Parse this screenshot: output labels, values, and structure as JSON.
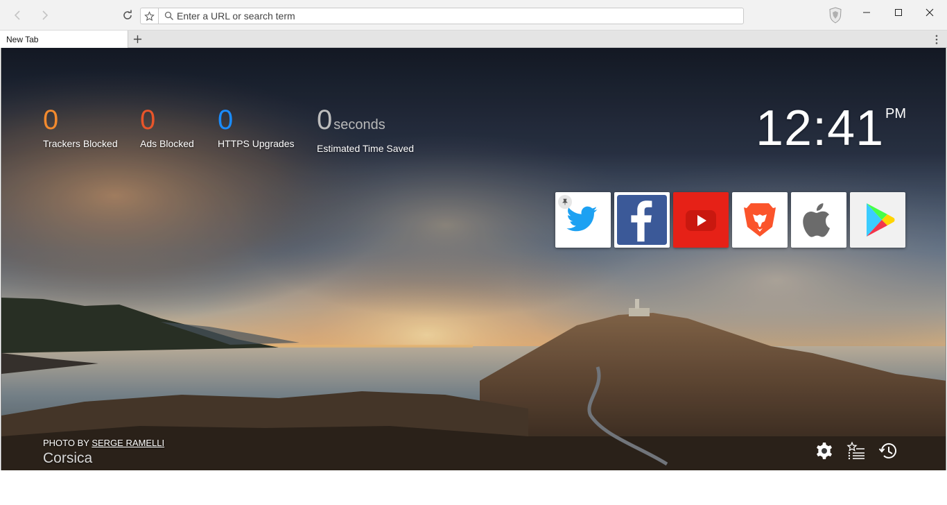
{
  "browser": {
    "address_placeholder": "Enter a URL or search term",
    "tab_title": "New Tab",
    "icons": [
      "back-icon",
      "forward-icon",
      "reload-icon",
      "bookmark-star-icon",
      "search-icon",
      "brave-shield-icon",
      "minimize-icon",
      "maximize-icon",
      "close-icon",
      "new-tab-plus-icon",
      "menu-kebab-icon"
    ]
  },
  "stats": [
    {
      "value": "0",
      "label": "Trackers Blocked",
      "color": "#f28a2e"
    },
    {
      "value": "0",
      "label": "Ads Blocked",
      "color": "#e8552a"
    },
    {
      "value": "0",
      "label": "HTTPS Upgrades",
      "color": "#1a8cff"
    },
    {
      "value": "0",
      "unit": "seconds",
      "label": "Estimated Time Saved",
      "color": "#bdbdbd"
    }
  ],
  "clock": {
    "time": "12:41",
    "ampm": "PM"
  },
  "top_sites": [
    {
      "name": "twitter",
      "icon": "twitter-bird-icon",
      "color": "#1da1f2",
      "pinned": true
    },
    {
      "name": "facebook",
      "icon": "facebook-f-icon",
      "color": "#3b5998",
      "pinned": false
    },
    {
      "name": "youtube",
      "icon": "youtube-play-icon",
      "color": "#e62117",
      "pinned": false
    },
    {
      "name": "brave",
      "icon": "brave-lion-icon",
      "color": "#fb542b",
      "pinned": false
    },
    {
      "name": "apple",
      "icon": "apple-logo-icon",
      "color": "#666666",
      "pinned": false
    },
    {
      "name": "google-play",
      "icon": "google-play-icon",
      "color": "#34a853",
      "pinned": false
    }
  ],
  "credit": {
    "prefix": "PHOTO BY ",
    "author": "SERGE RAMELLI",
    "location": "Corsica"
  },
  "actions": [
    {
      "name": "settings",
      "icon": "gear-icon"
    },
    {
      "name": "bookmarks",
      "icon": "bookmarks-list-icon"
    },
    {
      "name": "history",
      "icon": "history-clock-icon"
    }
  ]
}
